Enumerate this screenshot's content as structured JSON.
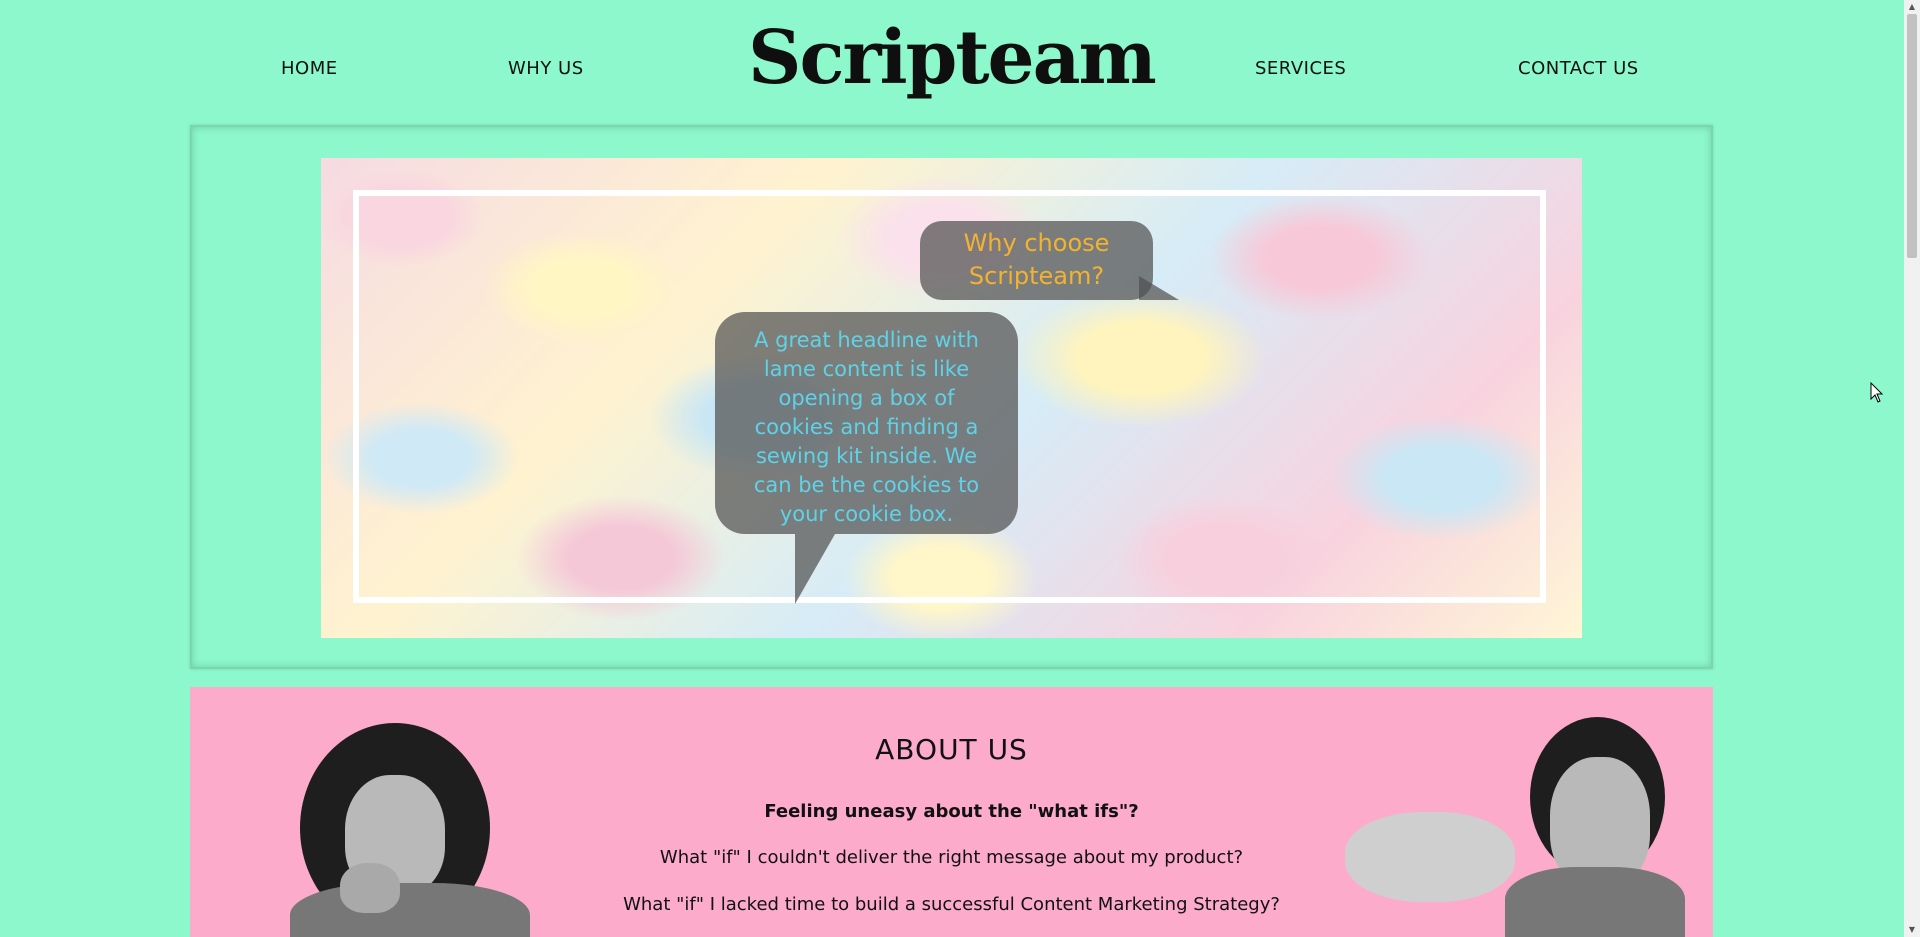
{
  "nav": {
    "home": "HOME",
    "why_us": "WHY US",
    "logo": "Scripteam",
    "services": "SERVICES",
    "contact": "CONTACT US"
  },
  "hero": {
    "question": "Why choose Scripteam?",
    "answer": "A great headline with lame content is like opening a box of cookies and finding a sewing kit inside. We can be the cookies to your cookie box."
  },
  "about": {
    "title": "ABOUT US",
    "lead": "Feeling uneasy about the \"what ifs\"?",
    "line1": "What \"if\" I couldn't deliver the right message about my product?",
    "line2": "What \"if\" I lacked time to build a successful Content Marketing Strategy?"
  },
  "colors": {
    "background": "#8cf8cb",
    "about_bg": "#fdabcb",
    "question_text": "#f1b330",
    "answer_text": "#5fd2e8"
  }
}
